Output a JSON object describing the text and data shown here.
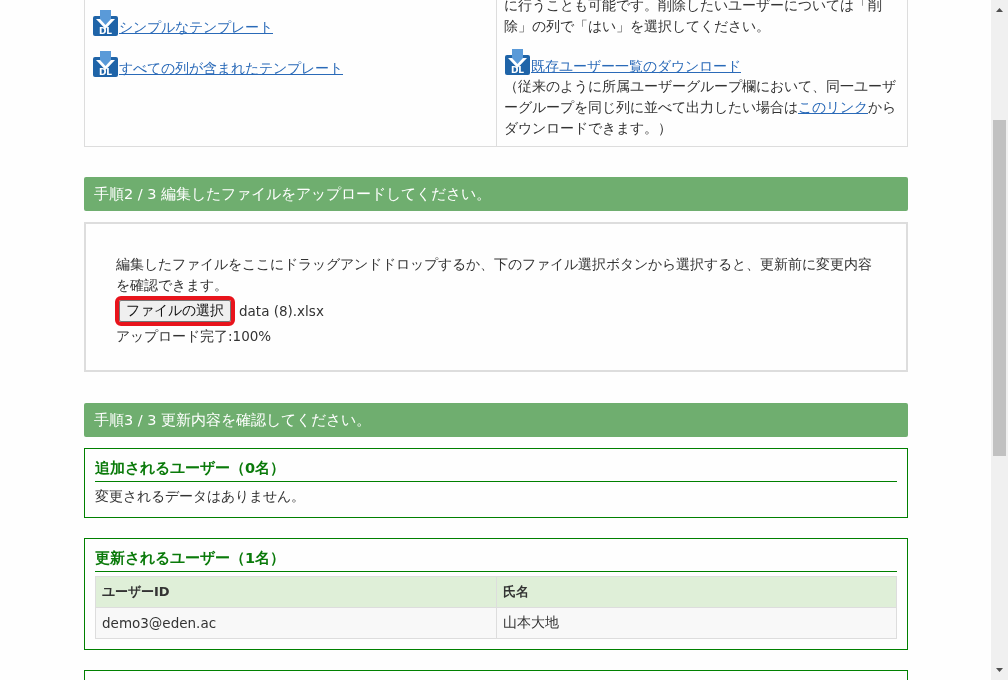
{
  "step1": {
    "templates": [
      {
        "icon": "DL",
        "label": "シンプルなテンプレート"
      },
      {
        "icon": "DL",
        "label": "すべての列が含まれたテンプレート"
      }
    ],
    "right_text": [
      "に行うことも可能です。削除したいユーザーについては「削",
      "除」の列で「はい」を選択してください。"
    ],
    "download": {
      "icon": "DL",
      "label": "既存ユーザー一覧のダウンロード"
    },
    "note": {
      "before": "（従来のように所属ユーザーグループ欄において、同一ユーザーグループを同じ列に並べて出力したい場合は",
      "link": "このリンク",
      "after": "からダウンロードできます。）"
    }
  },
  "step2": {
    "title": "手順2 / 3 編集したファイルをアップロードしてください。",
    "description": "編集したファイルをここにドラッグアンドドロップするか、下のファイル選択ボタンから選択すると、更新前に変更内容を確認できます。",
    "file_button": {
      "label": "ファイルの選択",
      "highlighted": true
    },
    "file_name": "data (8).xlsx",
    "progress": "アップロード完了:100%"
  },
  "step3": {
    "title": "手順3 / 3 更新内容を確認してください。",
    "sections": [
      {
        "kind": "empty",
        "title": "追加されるユーザー（0名）",
        "message": "変更されるデータはありません。"
      },
      {
        "kind": "table",
        "title": "更新されるユーザー（1名）",
        "columns": [
          "ユーザーID",
          "氏名"
        ],
        "rows": [
          [
            "demo3@eden.ac",
            "山本大地"
          ]
        ]
      },
      {
        "kind": "cut"
      }
    ]
  }
}
